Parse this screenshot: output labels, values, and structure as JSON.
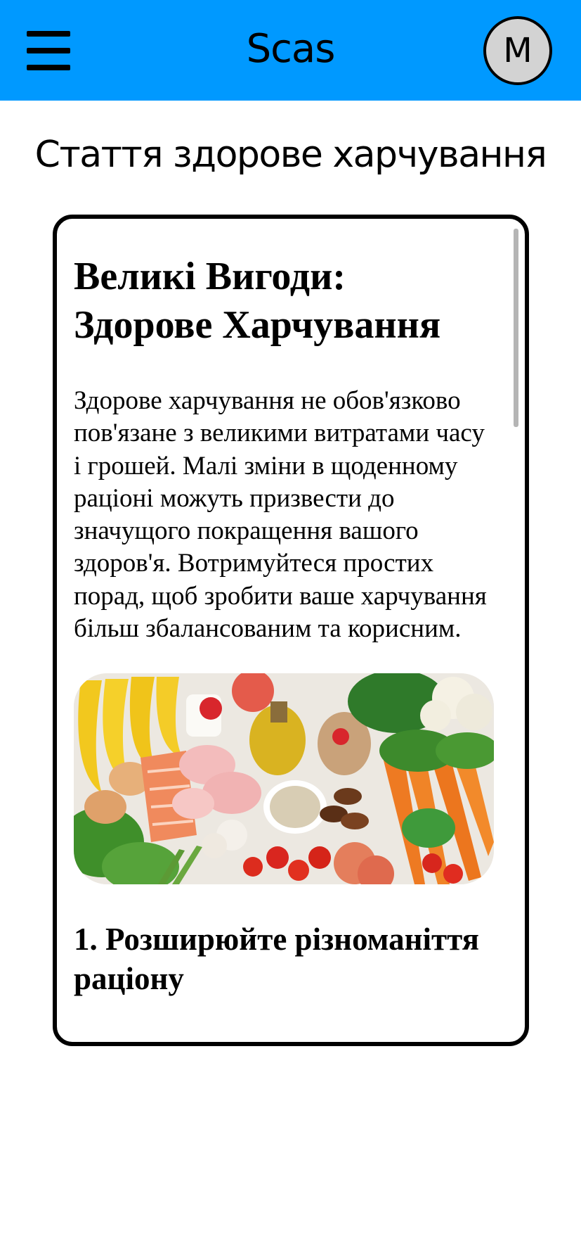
{
  "header": {
    "app_title": "Scas",
    "avatar_initial": "M",
    "menu_icon": "hamburger-menu-icon",
    "background_color": "#0099ff"
  },
  "page": {
    "heading": "Стаття здорове харчування"
  },
  "article": {
    "title": "Великі Вигоди: Здорове Харчування",
    "intro": "Здорове харчування не обов'язково пов'язане з великими витратами часу і грошей. Малі зміни в щоденному раціоні можуть призвести до значущого покращення вашого здоров'я. Вотримуйтеся простих порад, щоб зробити ваше харчування більш збалансованим та корисним.",
    "image_subject": "healthy-food-assortment-photo",
    "section_1_title": "1. Розширюйте різноманіття раціону"
  }
}
